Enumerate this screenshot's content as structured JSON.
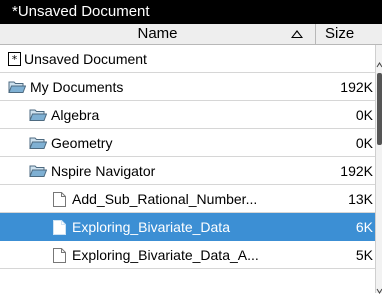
{
  "window": {
    "title": "*Unsaved Document"
  },
  "columns": {
    "name": "Name",
    "size": "Size"
  },
  "rows": [
    {
      "label": "Unsaved Document",
      "size": "",
      "icon": "document-star-icon"
    },
    {
      "label": "My Documents",
      "size": "192K",
      "icon": "folder-open-icon"
    },
    {
      "label": "Algebra",
      "size": "0K",
      "icon": "folder-open-icon"
    },
    {
      "label": "Geometry",
      "size": "0K",
      "icon": "folder-open-icon"
    },
    {
      "label": "Nspire Navigator",
      "size": "192K",
      "icon": "folder-open-icon"
    },
    {
      "label": "Add_Sub_Rational_Number...",
      "size": "13K",
      "icon": "document-icon"
    },
    {
      "label": "Exploring_Bivariate_Data",
      "size": "6K",
      "icon": "document-icon",
      "selected": true
    },
    {
      "label": "Exploring_Bivariate_Data_A...",
      "size": "5K",
      "icon": "document-icon"
    }
  ],
  "colors": {
    "selection": "#3c8fd4",
    "folder": "#7fb0d3",
    "titlebar": "#000000"
  }
}
